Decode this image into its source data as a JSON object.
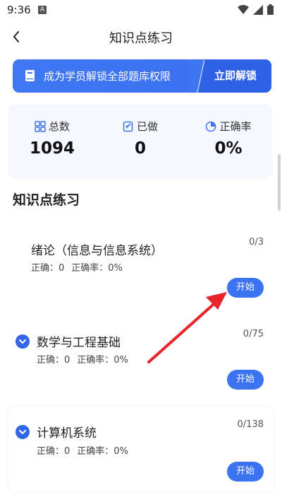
{
  "status": {
    "time": "9:36",
    "notification": "A"
  },
  "nav": {
    "title": "知识点练习"
  },
  "banner": {
    "text": "成为学员解锁全部题库权限",
    "button": "立即解锁"
  },
  "stats": [
    {
      "label": "总数",
      "value": "1094"
    },
    {
      "label": "已做",
      "value": "0"
    },
    {
      "label": "正确率",
      "value": "0%"
    }
  ],
  "section": {
    "title": "知识点练习"
  },
  "topics": [
    {
      "name": "绪论（信息与信息系统）",
      "count": "0/3",
      "correct": "正确：0",
      "rate": "正确率：0%",
      "start": "开始"
    },
    {
      "name": "数学与工程基础",
      "count": "0/75",
      "correct": "正确：0",
      "rate": "正确率：0%",
      "start": "开始"
    },
    {
      "name": "计算机系统",
      "count": "0/138",
      "correct": "正确：0",
      "rate": "正确率：0%",
      "start": "开始"
    }
  ],
  "colors": {
    "accent": "#3b73f0",
    "annotation_arrow": "#e8232a"
  }
}
